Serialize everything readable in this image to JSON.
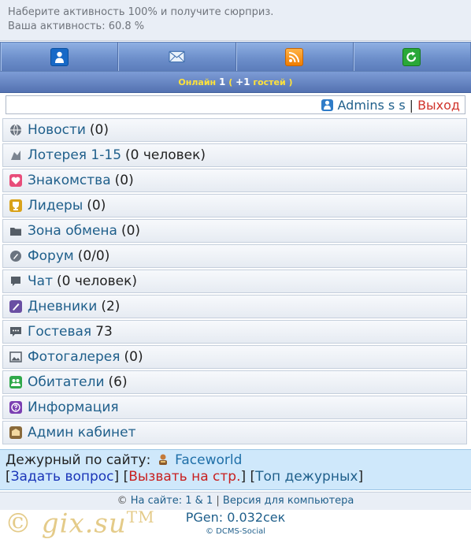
{
  "notice": {
    "line1": "Наберите активность 100% и получите сюрприз.",
    "line2": "Ваша активность: 60.8 %"
  },
  "navbar": {
    "items": [
      {
        "icon": "user-icon"
      },
      {
        "icon": "mail-icon"
      },
      {
        "icon": "rss-icon"
      },
      {
        "icon": "refresh-icon"
      }
    ]
  },
  "online": {
    "label": "Онлайн",
    "count": "1",
    "paren_open": "(",
    "guests": "+1",
    "guests_label": "гостей",
    "paren_close": ")"
  },
  "userbar": {
    "name": "Admins s s",
    "separator": "|",
    "logout": "Выход"
  },
  "menu": [
    {
      "label": "Новости",
      "count": "(0)",
      "icon": "news-globe-icon",
      "color": "#6b7480"
    },
    {
      "label": "Лотерея 1-15",
      "count": "(0 человек)",
      "icon": "lottery-icon",
      "color": "#7b8490"
    },
    {
      "label": "Знакомства",
      "count": "(0)",
      "icon": "heart-icon",
      "color": "#e84d7a"
    },
    {
      "label": "Лидеры",
      "count": "(0)",
      "icon": "trophy-icon",
      "color": "#d9a21a"
    },
    {
      "label": "Зона обмена",
      "count": "(0)",
      "icon": "folder-icon",
      "color": "#555d66"
    },
    {
      "label": "Форум",
      "count": "(0/0)",
      "icon": "forum-icon",
      "color": "#6b7480"
    },
    {
      "label": "Чат",
      "count": "(0 человек)",
      "icon": "chat-icon",
      "color": "#555d66"
    },
    {
      "label": "Дневники",
      "count": "(2)",
      "icon": "diary-icon",
      "color": "#6a4fa3"
    },
    {
      "label": "Гостевая",
      "count": "73",
      "icon": "guestbook-icon",
      "color": "#555d66"
    },
    {
      "label": "Фотогалерея",
      "count": "(0)",
      "icon": "photo-icon",
      "color": "#555d66"
    },
    {
      "label": "Обитатели",
      "count": "(6)",
      "icon": "users-icon",
      "color": "#2fa84a"
    },
    {
      "label": "Информация",
      "count": "",
      "icon": "info-icon",
      "color": "#7b3fb2"
    },
    {
      "label": "Админ кабинет",
      "count": "",
      "icon": "admin-icon",
      "color": "#8a6a3a"
    }
  ],
  "duty": {
    "label": "Дежурный по сайту:",
    "name": "Faceworld",
    "ask": "Задать вопрос",
    "call": "Вызвать на стр.",
    "top": "Топ дежурных"
  },
  "footer": {
    "copyright_sign": "©",
    "on_site_label": "На сайте:",
    "on_site_value": "1 & 1",
    "sep": "|",
    "desktop_link": "Версия для компьютера",
    "pgen": "PGen: 0.032сек",
    "credit": "© DCMS-Social"
  },
  "watermark": {
    "text": "© gix.su",
    "tm": "TM"
  }
}
